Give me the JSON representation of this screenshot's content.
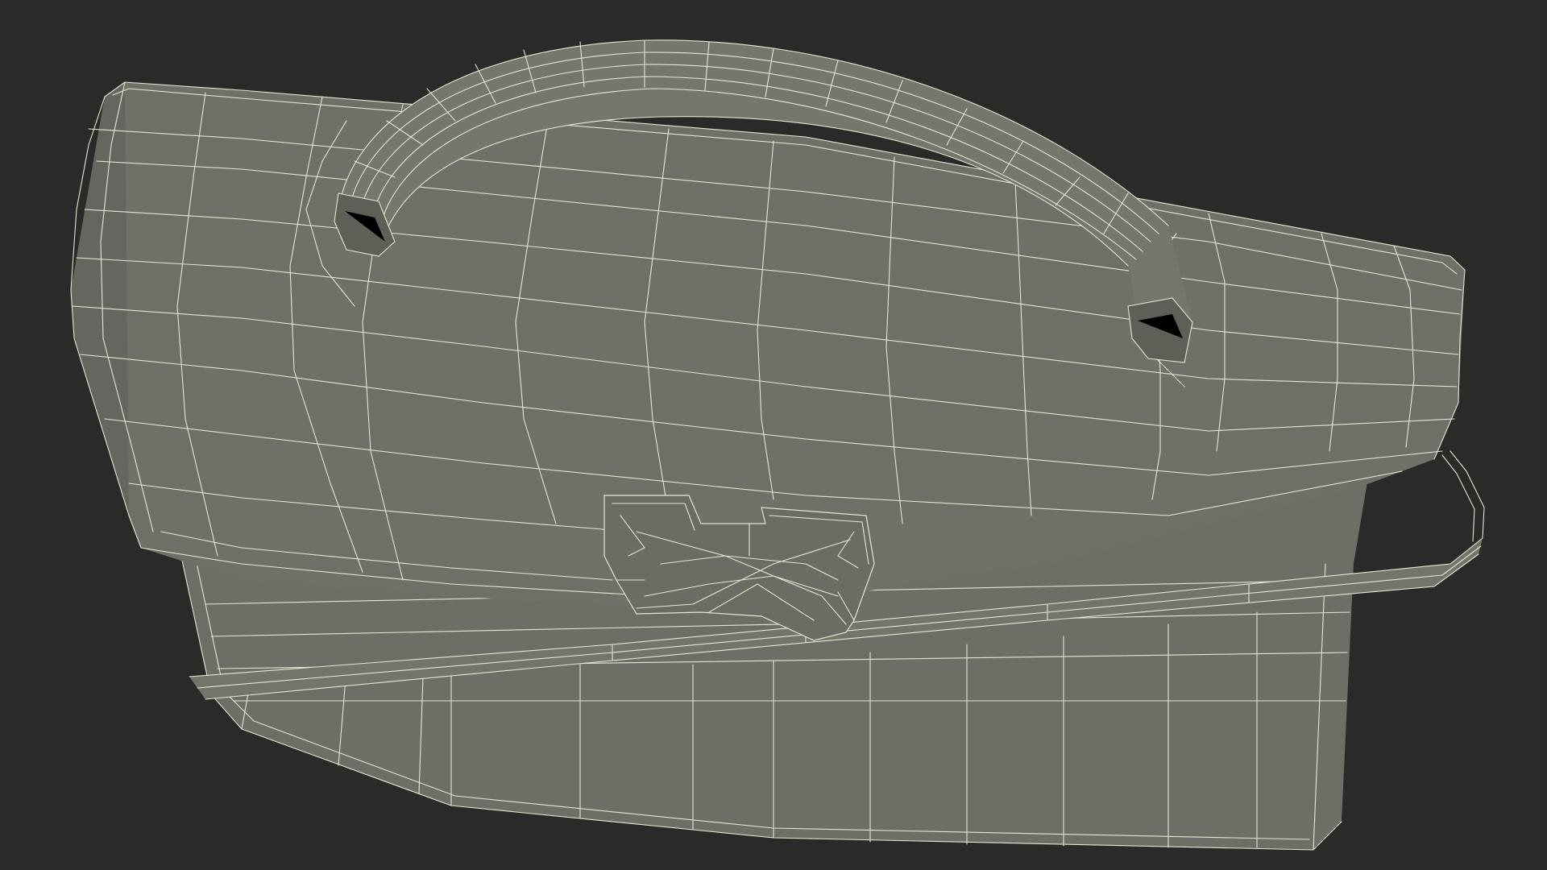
{
  "scene": {
    "background_color": "#2a2a28",
    "mesh_color": "#707068",
    "mesh_shadow_color": "#5e5e56",
    "mesh_highlight_color": "#7c7c72",
    "wire_color": "#e6e6d2",
    "render_mode": "wireframe-on-shaded",
    "subject": "briefcase"
  }
}
